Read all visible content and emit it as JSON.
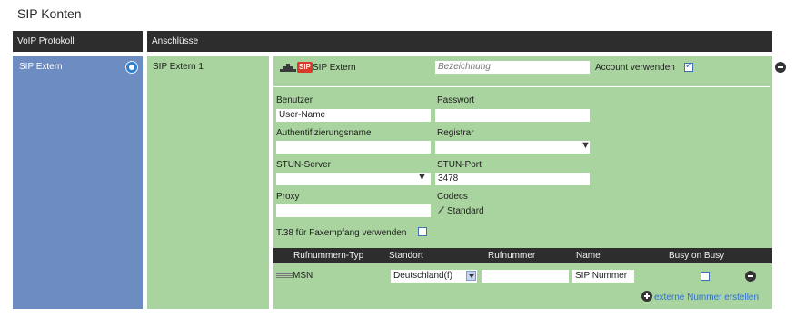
{
  "page_title": "SIP Konten",
  "header": {
    "left": "VoIP Protokoll",
    "right": "Anschlüsse"
  },
  "sidebar": {
    "items": [
      {
        "label": "SIP Extern",
        "icon": "gear-icon"
      }
    ]
  },
  "account": {
    "name": "SIP Extern 1",
    "provider_badge": "SIP",
    "provider_label": "SIP Extern",
    "bezeichnung_placeholder": "Bezeichnung",
    "use_account_label": "Account verwenden",
    "use_account_checked": true,
    "fields": {
      "benutzer_label": "Benutzer",
      "benutzer_value": "User-Name",
      "passwort_label": "Passwort",
      "passwort_value": "",
      "auth_label": "Authentifizierungsname",
      "auth_value": "",
      "registrar_label": "Registrar",
      "registrar_value": "",
      "stun_server_label": "STUN-Server",
      "stun_server_value": "",
      "stun_port_label": "STUN-Port",
      "stun_port_value": "3478",
      "proxy_label": "Proxy",
      "proxy_value": "",
      "codecs_label": "Codecs",
      "codecs_value": "Standard"
    },
    "t38_label": "T.38 für Faxempfang verwenden",
    "t38_checked": false
  },
  "numbers_table": {
    "columns": [
      "Rufnummern-Typ",
      "Standort",
      "Rufnummer",
      "Name",
      "Busy on Busy"
    ],
    "rows": [
      {
        "type": "MSN",
        "standort": "Deutschland(f)",
        "rufnummer": "",
        "name": "SIP Nummer",
        "busy_on_busy": false
      }
    ],
    "add_label": "externe Nummer erstellen"
  },
  "colors": {
    "header": "#2d2d2d",
    "sidebar": "#6c8cc2",
    "panel": "#a9d49f",
    "accent": "#3c6fb4"
  }
}
